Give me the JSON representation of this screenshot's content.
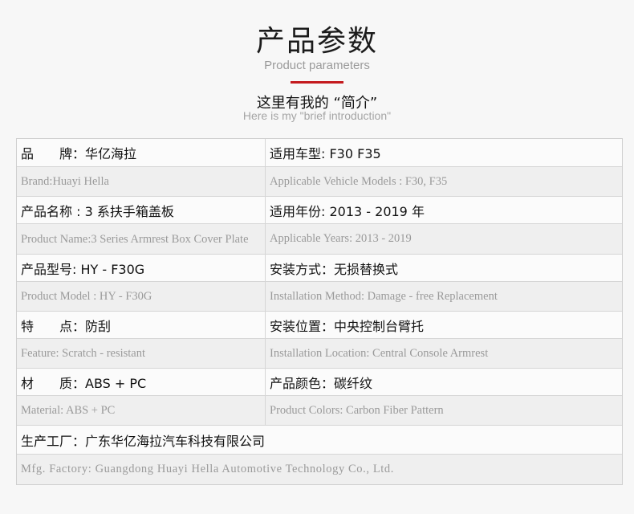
{
  "header": {
    "title": "产品参数",
    "subtitle": "Product parameters",
    "intro_title": "这里有我的 “简介”",
    "intro_subtitle": "Here is my \"brief introduction\"",
    "accent_color": "#c41a1e"
  },
  "specs": {
    "brand_cn": "品　　牌：华亿海拉",
    "brand_en": "Brand:Huayi Hella",
    "vehicle_cn": "适用车型: F30 F35",
    "vehicle_en": "Applicable Vehicle Models : F30, F35",
    "name_cn": "产品名称 : 3 系扶手箱盖板",
    "name_en": "Product Name:3 Series Armrest Box Cover Plate",
    "years_cn": "适用年份:  2013  -  2019  年",
    "years_en": "Applicable Years:  2013 - 2019",
    "model_cn": "产品型号:  HY  -  F30G",
    "model_en": "Product Model : HY - F30G",
    "install_cn": "安装方式：无损替换式",
    "install_en": "Installation Method:  Damage - free Replacement",
    "feature_cn": "特　　点：防刮",
    "feature_en": "Feature: Scratch - resistant",
    "location_cn": "安装位置：中央控制台臂托",
    "location_en": "Installation Location: Central Console Armrest",
    "material_cn": "材　　质：ABS  +  PC",
    "material_en": "Material: ABS + PC",
    "color_cn": "产品颜色：碳纤纹",
    "color_en": "Product Colors: Carbon Fiber Pattern",
    "factory_cn": "生产工厂：广东华亿海拉汽车科技有限公司",
    "factory_en": "Mfg. Factory: Guangdong Huayi Hella Automotive Technology Co., Ltd."
  }
}
